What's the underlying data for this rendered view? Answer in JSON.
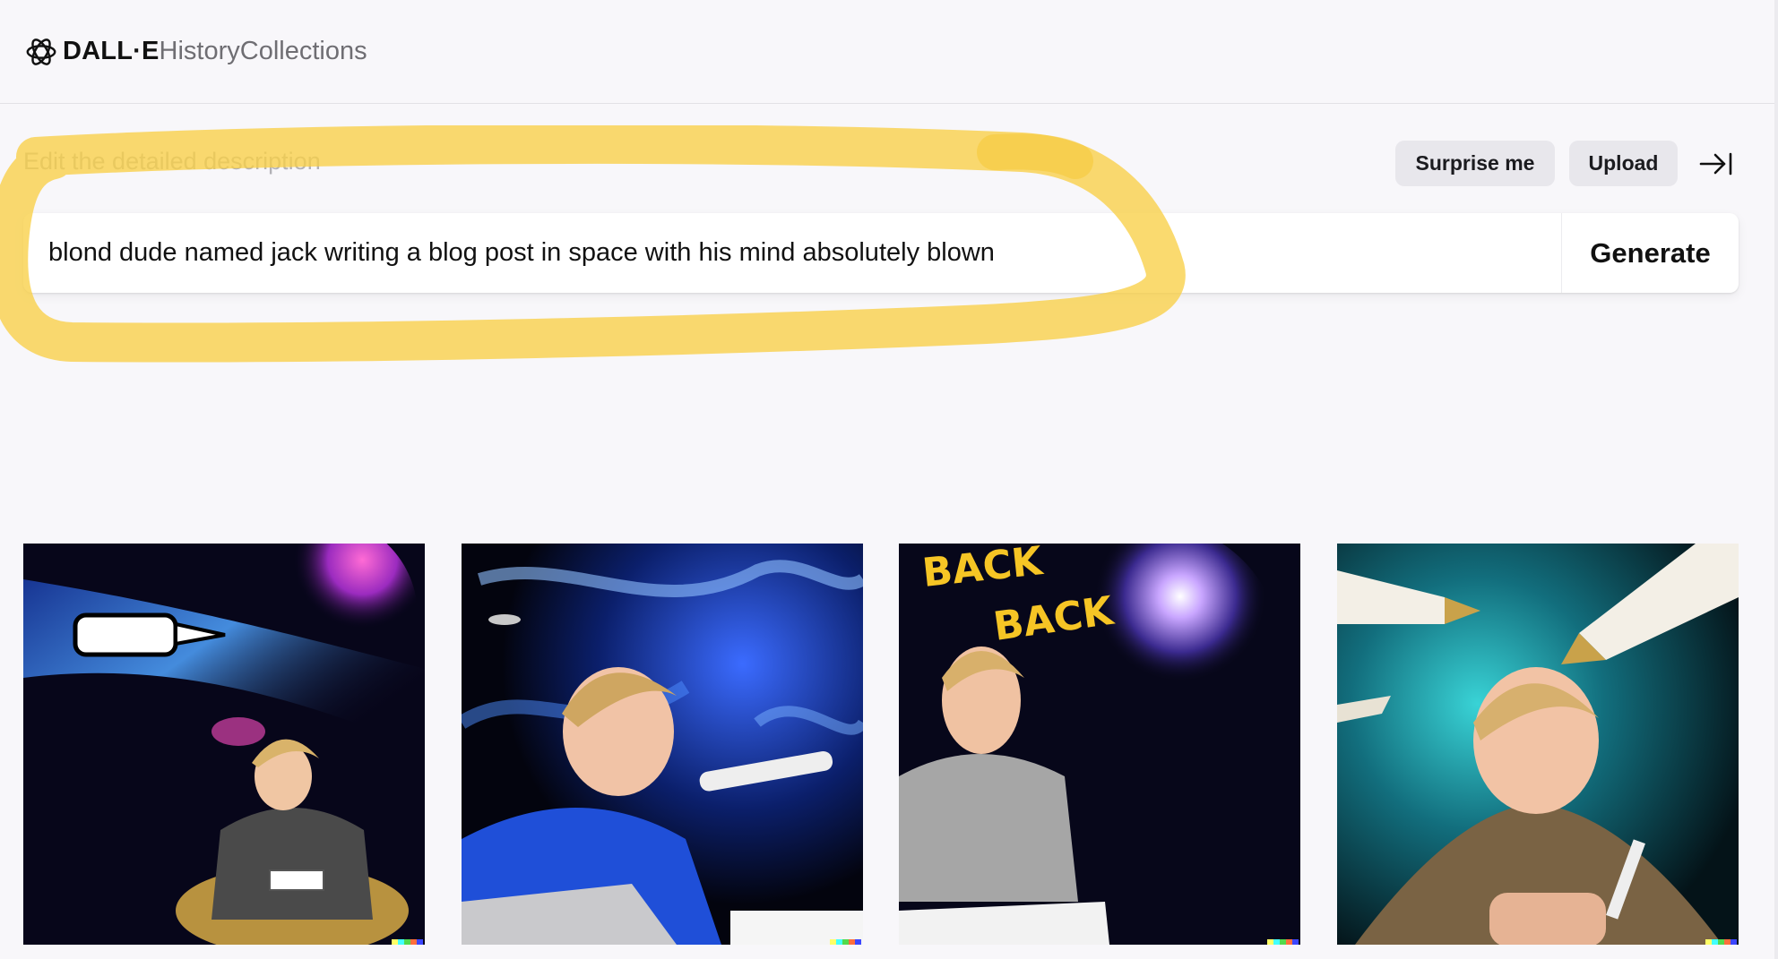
{
  "header": {
    "brand": "DALL·E",
    "nav": [
      "History",
      "Collections"
    ]
  },
  "prompt": {
    "label": "Edit the detailed description",
    "value": "blond dude named jack writing a blog post in space with his mind absolutely blown",
    "generate_label": "Generate"
  },
  "actions": {
    "surprise_label": "Surprise me",
    "upload_label": "Upload"
  },
  "images": [
    {
      "caption_text": ""
    },
    {
      "caption_text": ""
    },
    {
      "caption_text": "BACK BACK"
    },
    {
      "caption_text": ""
    }
  ],
  "colors": {
    "highlight": "#f9d046",
    "button_bg": "#e8e7ec",
    "page_bg": "#f8f7fa"
  },
  "icons": {
    "logo": "openai-logo-icon",
    "collapse": "arrow-right-to-line-icon"
  }
}
